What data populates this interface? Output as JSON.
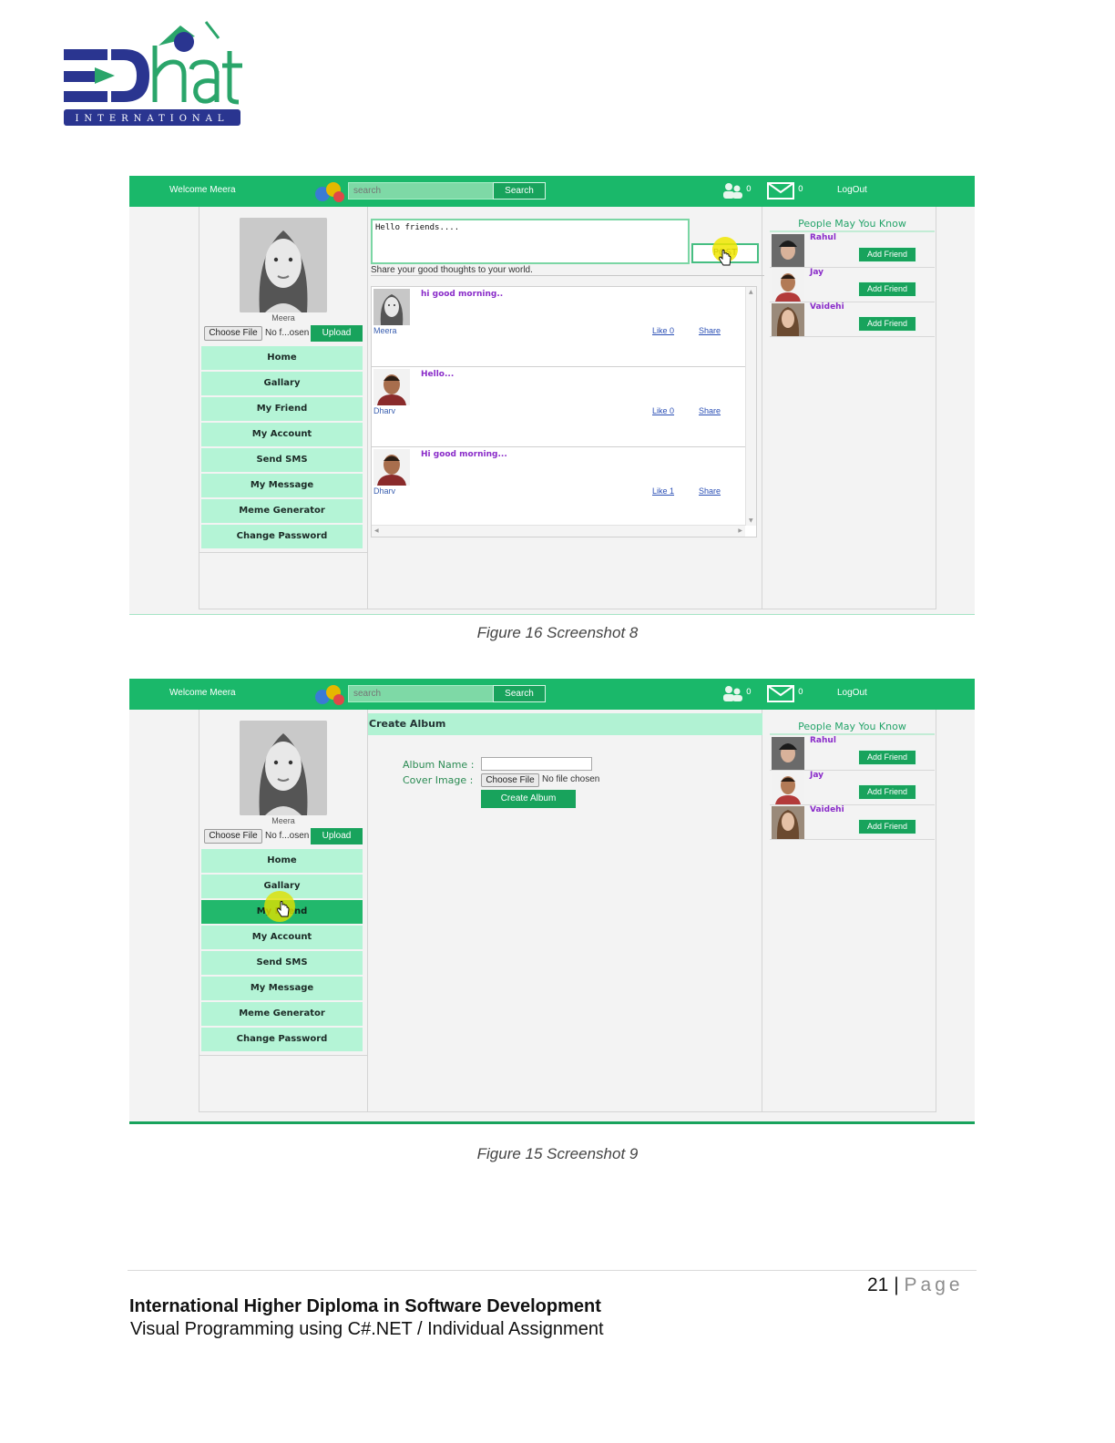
{
  "logo": {
    "main": "ED",
    "accent": "hat",
    "tagline": "INTERNATIONAL"
  },
  "screenshots": [
    {
      "topbar": {
        "welcome": "Welcome Meera",
        "search_placeholder": "search",
        "search_label": "Search",
        "friend_requests": "0",
        "messages": "0",
        "logout": "LogOut"
      },
      "profile": {
        "name": "Meera",
        "choose_file": "Choose File",
        "file_status": "No f...osen",
        "upload": "Upload"
      },
      "menu": [
        "Home",
        "Gallary",
        "My Friend",
        "My Account",
        "Send SMS",
        "My Message",
        "Meme Generator",
        "Change Password"
      ],
      "active_menu": -1,
      "post": {
        "text": "Hello friends....",
        "button": "POST",
        "hint": "Share your good thoughts to your world."
      },
      "feed": [
        {
          "user": "Meera",
          "text": "hi good morning..",
          "like": "Like 0",
          "share": "Share"
        },
        {
          "user": "Dharv",
          "text": "Hello...",
          "like": "Like 0",
          "share": "Share"
        },
        {
          "user": "Dharv",
          "text": "Hi good morning...",
          "like": "Like 1",
          "share": "Share"
        }
      ],
      "people": {
        "title": "People May You Know",
        "items": [
          {
            "name": "Rahul",
            "button": "Add Friend"
          },
          {
            "name": "Jay",
            "button": "Add Friend"
          },
          {
            "name": "Vaidehi",
            "button": "Add Friend"
          }
        ]
      },
      "caption": "Figure 16 Screenshot 8"
    },
    {
      "topbar": {
        "welcome": "Welcome Meera",
        "search_placeholder": "search",
        "search_label": "Search",
        "friend_requests": "0",
        "messages": "0",
        "logout": "LogOut"
      },
      "profile": {
        "name": "Meera",
        "choose_file": "Choose File",
        "file_status": "No f...osen",
        "upload": "Upload"
      },
      "menu": [
        "Home",
        "Gallary",
        "My Friend",
        "My Account",
        "Send SMS",
        "My Message",
        "Meme Generator",
        "Change Password"
      ],
      "active_menu": 2,
      "album": {
        "title": "Create Album",
        "name_label": "Album Name :",
        "cover_label": "Cover Image :",
        "choose_file": "Choose File",
        "file_status": "No file chosen",
        "create": "Create Album"
      },
      "people": {
        "title": "People May You Know",
        "items": [
          {
            "name": "Rahul",
            "button": "Add Friend"
          },
          {
            "name": "Jay",
            "button": "Add Friend"
          },
          {
            "name": "Vaidehi",
            "button": "Add Friend"
          }
        ]
      },
      "caption": "Figure 15 Screenshot 9"
    }
  ],
  "footer": {
    "page_number": "21",
    "separator": "|",
    "page_word": "Page",
    "title": "International Higher Diploma in Software Development",
    "subtitle": "Visual Programming using C#.NET / Individual Assignment"
  },
  "colors": {
    "brand_green": "#1ab86a",
    "menu_green": "#b4f4d6",
    "logo_navy": "#2a3590",
    "logo_green": "#2aa56a"
  }
}
